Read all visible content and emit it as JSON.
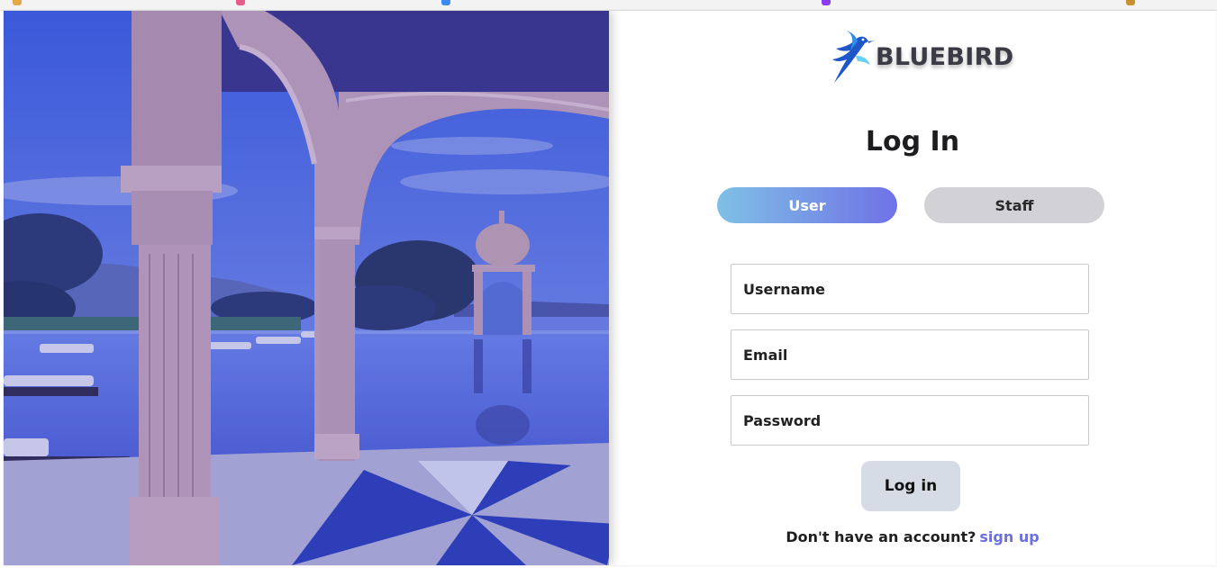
{
  "brand": {
    "name": "BLUEBIRD",
    "logo_icon": "bluebird-logo-icon",
    "logo_colors": [
      "#1e58c8",
      "#2f8fe8",
      "#6bd0f5"
    ]
  },
  "hero": {
    "image": "palace-infinity-pool-photo",
    "overlay_color": "#3a3fbf"
  },
  "login": {
    "title": "Log In",
    "tabs": [
      {
        "label": "User",
        "active": true
      },
      {
        "label": "Staff",
        "active": false
      }
    ],
    "fields": {
      "username_placeholder": "Username",
      "email_placeholder": "Email",
      "password_placeholder": "Password"
    },
    "submit_label": "Log in",
    "signup_prompt": "Don't have an account?",
    "signup_link": "sign up"
  },
  "colors": {
    "accent_gradient_start": "#7fc0e6",
    "accent_gradient_end": "#6f72e6",
    "link": "#6b6fe0",
    "inactive_tab": "#d2d2d6",
    "submit_bg": "#d6dce5"
  }
}
